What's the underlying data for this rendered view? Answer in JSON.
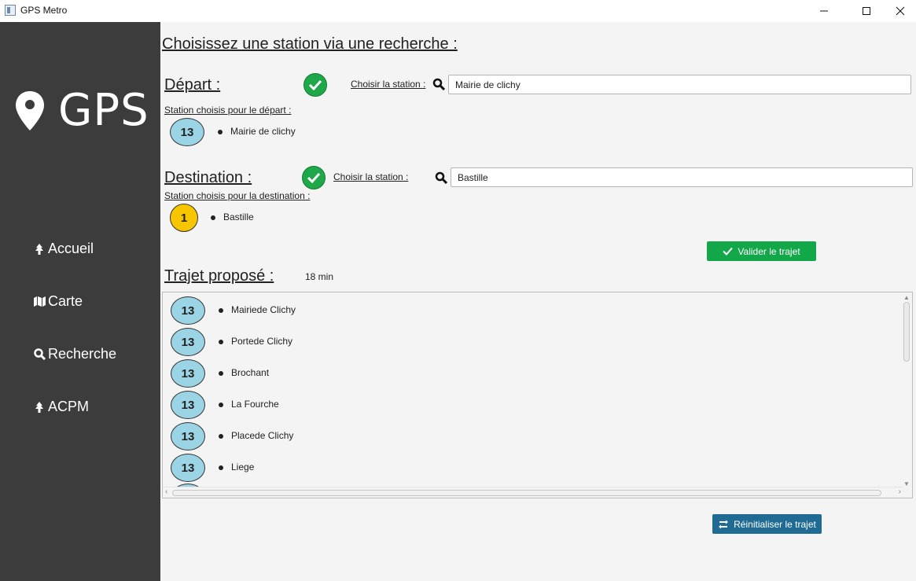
{
  "window": {
    "title": "GPS Metro"
  },
  "sidebar": {
    "logo_text": "GPS",
    "items": [
      {
        "label": "Accueil",
        "icon": "tree-icon"
      },
      {
        "label": "Carte",
        "icon": "map-icon"
      },
      {
        "label": "Recherche",
        "icon": "search-icon"
      },
      {
        "label": "ACPM",
        "icon": "tree-icon"
      }
    ]
  },
  "main": {
    "heading": "Choisissez une station via une recherche :",
    "depart": {
      "title": "Départ :",
      "choose_label": "Choisir la station :",
      "search_value": "Mairie de clichy",
      "chosen_label": "Station choisis pour le départ :",
      "line": "13",
      "station": "Mairie de clichy"
    },
    "destination": {
      "title": "Destination :",
      "choose_label": "Choisir la station :",
      "search_value": "Bastille",
      "chosen_label": "Station choisis pour la destination :",
      "line": "1",
      "station": "Bastille"
    },
    "validate_button": "Valider le trajet",
    "trajet": {
      "title": "Trajet proposé :",
      "duration": "18 min",
      "stops": [
        {
          "line": "13",
          "station": "Mairiede Clichy"
        },
        {
          "line": "13",
          "station": "Portede Clichy"
        },
        {
          "line": "13",
          "station": "Brochant"
        },
        {
          "line": "13",
          "station": "La Fourche"
        },
        {
          "line": "13",
          "station": "Placede Clichy"
        },
        {
          "line": "13",
          "station": "Liege"
        }
      ]
    },
    "reset_button": "Réinitialiser le trajet"
  },
  "colors": {
    "sidebar_bg": "#3c3c3c",
    "line13": "#9bd4e4",
    "line1": "#f7c600",
    "validate_green": "#12a84a",
    "reset_blue": "#1f6b93",
    "check_green": "#1fa84a"
  }
}
